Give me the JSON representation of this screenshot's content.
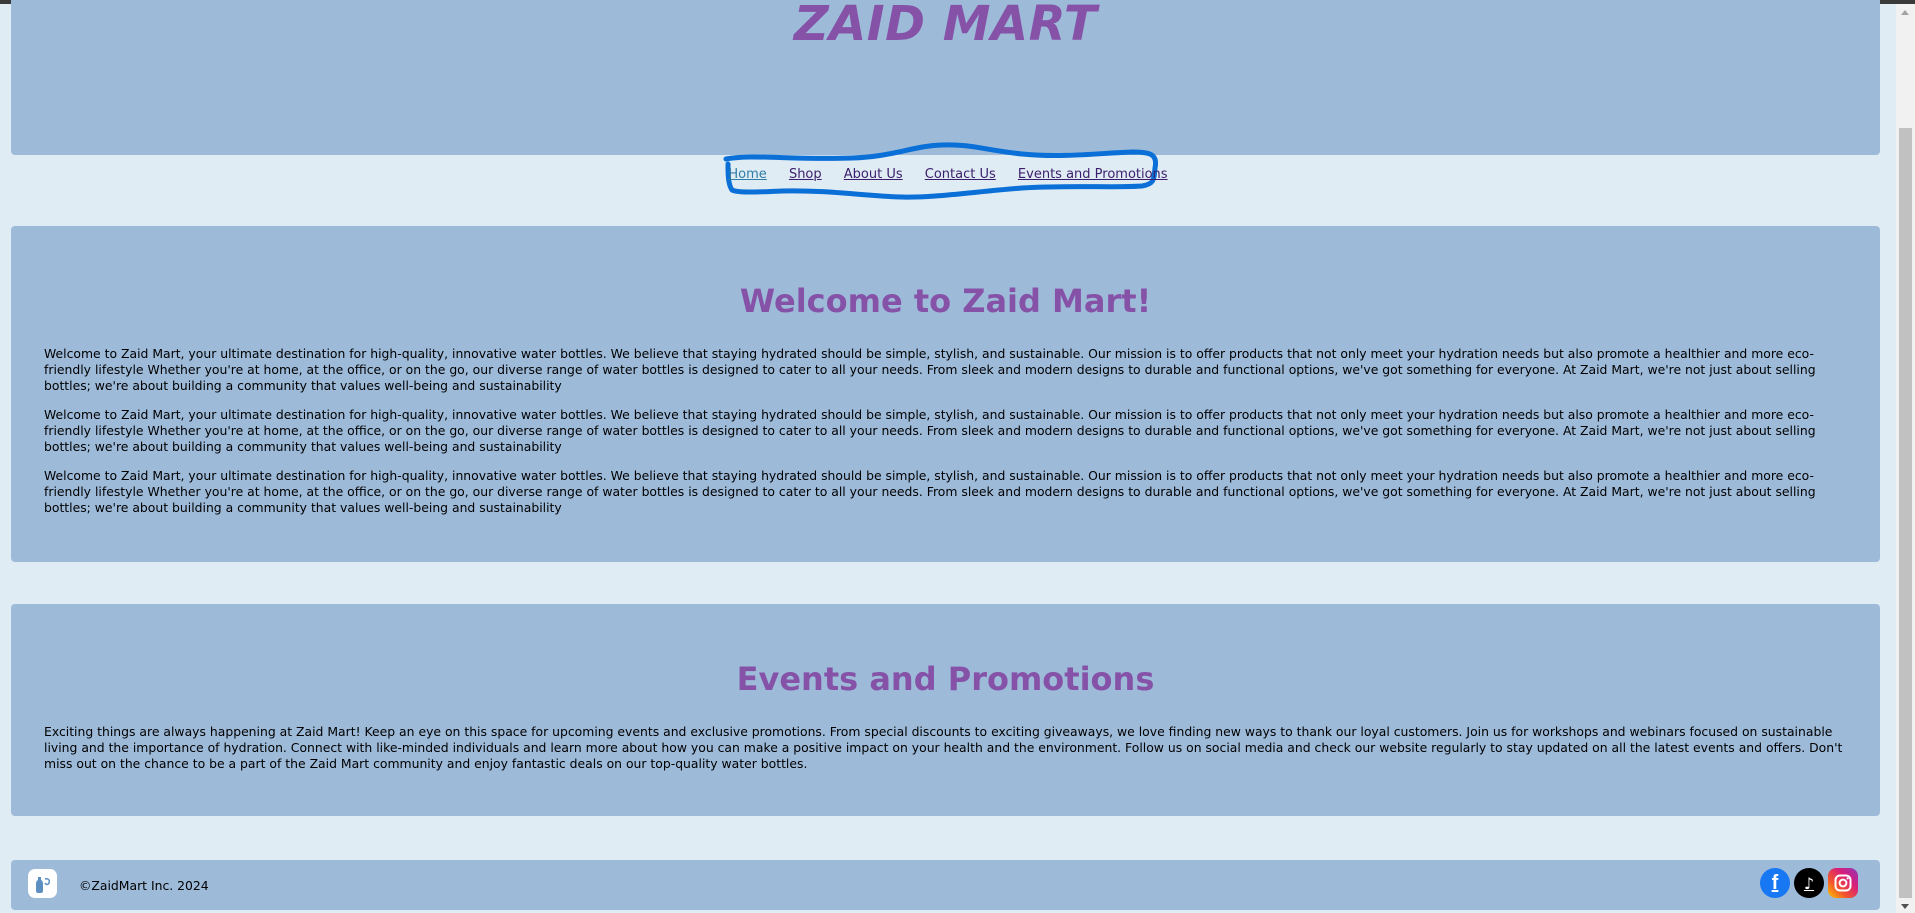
{
  "header": {
    "title": "ZAID MART"
  },
  "nav": {
    "items": [
      "Home",
      "Shop",
      "About Us",
      "Contact Us",
      "Events and Promotions"
    ],
    "active": "Home"
  },
  "welcome": {
    "heading": "Welcome to Zaid Mart!",
    "paragraphs": [
      "Welcome to Zaid Mart, your ultimate destination for high-quality, innovative water bottles. We believe that staying hydrated should be simple, stylish, and sustainable. Our mission is to offer products that not only meet your hydration needs but also promote a healthier and more eco-friendly lifestyle Whether you're at home, at the office, or on the go, our diverse range of water bottles is designed to cater to all your needs. From sleek and modern designs to durable and functional options, we've got something for everyone. At Zaid Mart, we're not just about selling bottles; we're about building a community that values well-being and sustainability",
      "Welcome to Zaid Mart, your ultimate destination for high-quality, innovative water bottles. We believe that staying hydrated should be simple, stylish, and sustainable. Our mission is to offer products that not only meet your hydration needs but also promote a healthier and more eco-friendly lifestyle Whether you're at home, at the office, or on the go, our diverse range of water bottles is designed to cater to all your needs. From sleek and modern designs to durable and functional options, we've got something for everyone. At Zaid Mart, we're not just about selling bottles; we're about building a community that values well-being and sustainability",
      "Welcome to Zaid Mart, your ultimate destination for high-quality, innovative water bottles. We believe that staying hydrated should be simple, stylish, and sustainable. Our mission is to offer products that not only meet your hydration needs but also promote a healthier and more eco-friendly lifestyle Whether you're at home, at the office, or on the go, our diverse range of water bottles is designed to cater to all your needs. From sleek and modern designs to durable and functional options, we've got something for everyone. At Zaid Mart, we're not just about selling bottles; we're about building a community that values well-being and sustainability"
    ]
  },
  "events": {
    "heading": "Events and Promotions",
    "paragraph": "Exciting things are always happening at Zaid Mart! Keep an eye on this space for upcoming events and exclusive promotions. From special discounts to exciting giveaways, we love finding new ways to thank our loyal customers. Join us for workshops and webinars focused on sustainable living and the importance of hydration. Connect with like-minded individuals and learn more about how you can make a positive impact on your health and the environment. Follow us on social media and check our website regularly to stay updated on all the latest events and offers. Don't miss out on the chance to be a part of the Zaid Mart community and enjoy fantastic deals on our top-quality water bottles."
  },
  "footer": {
    "copyright": "©ZaidMart Inc. 2024",
    "social_icons": [
      "facebook-icon",
      "tiktok-icon",
      "instagram-icon"
    ]
  },
  "colors": {
    "page_bg": "#e0ecf4",
    "panel_bg": "#9dbad9",
    "accent_purple": "#8652a8",
    "nav_link": "#3b1e6b",
    "nav_active": "#2f7da6",
    "annotation_blue": "#0a6fd6"
  }
}
